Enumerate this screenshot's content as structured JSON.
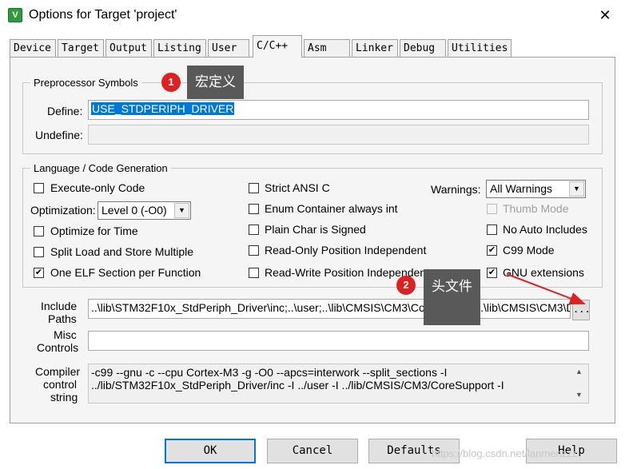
{
  "window": {
    "title": "Options for Target 'project'",
    "icon_label": "V",
    "close_glyph": "✕"
  },
  "tabs": [
    "Device",
    "Target",
    "Output",
    "Listing",
    "User",
    "C/C++",
    "Asm",
    "Linker",
    "Debug",
    "Utilities"
  ],
  "active_tab": "C/C++",
  "preprocessor": {
    "group_title": "Preprocessor Symbols",
    "define_label": "Define:",
    "define_value": "USE_STDPERIPH_DRIVER",
    "undefine_label": "Undefine:",
    "undefine_value": ""
  },
  "codegen": {
    "group_title": "Language / Code Generation",
    "execute_only": {
      "label": "Execute-only Code",
      "checked": false
    },
    "optimization_label": "Optimization:",
    "optimization_value": "Level 0 (-O0)",
    "optimize_time": {
      "label": "Optimize for Time",
      "checked": false
    },
    "split_load": {
      "label": "Split Load and Store Multiple",
      "checked": false
    },
    "one_elf": {
      "label": "One ELF Section per Function",
      "checked": true
    },
    "strict_ansi": {
      "label": "Strict ANSI C",
      "checked": false
    },
    "enum_container": {
      "label": "Enum Container always int",
      "checked": false
    },
    "plain_char": {
      "label": "Plain Char is Signed",
      "checked": false
    },
    "ro_position": {
      "label": "Read-Only Position Independent",
      "checked": false
    },
    "rw_position": {
      "label": "Read-Write Position Independent",
      "checked": false
    },
    "warnings_label": "Warnings:",
    "warnings_value": "All Warnings",
    "thumb_mode": {
      "label": "Thumb Mode",
      "checked": false,
      "disabled": true
    },
    "no_auto_includes": {
      "label": "No Auto Includes",
      "checked": false
    },
    "c99_mode": {
      "label": "C99 Mode",
      "checked": true
    },
    "gnu_extensions": {
      "label": "GNU extensions",
      "checked": true
    }
  },
  "paths": {
    "include_label_1": "Include",
    "include_label_2": "Paths",
    "include_value": "..\\lib\\STM32F10x_StdPeriph_Driver\\inc;..\\user;..\\lib\\CMSIS\\CM3\\CoreSupport;..\\lib\\CMSIS\\CM3\\D",
    "browse_label": "...",
    "misc_label_1": "Misc",
    "misc_label_2": "Controls",
    "misc_value": "",
    "compiler_label_1": "Compiler",
    "compiler_label_2": "control",
    "compiler_label_3": "string",
    "compiler_line_1": "-c99 --gnu -c --cpu Cortex-M3 -g -O0 --apcs=interwork --split_sections -I",
    "compiler_line_2": "../lib/STM32F10x_StdPeriph_Driver/inc -I ../user -I ../lib/CMSIS/CM3/CoreSupport -I"
  },
  "buttons": {
    "ok": "OK",
    "cancel": "Cancel",
    "defaults": "Defaults",
    "help": "Help"
  },
  "annotations": {
    "callout_1_number": "1",
    "callout_1_text": "宏定义",
    "callout_2_number": "2",
    "callout_2_text": "头文件",
    "arrow_color": "#e02020"
  },
  "watermark": "https://blog.csdn.net/lanmenzzz"
}
